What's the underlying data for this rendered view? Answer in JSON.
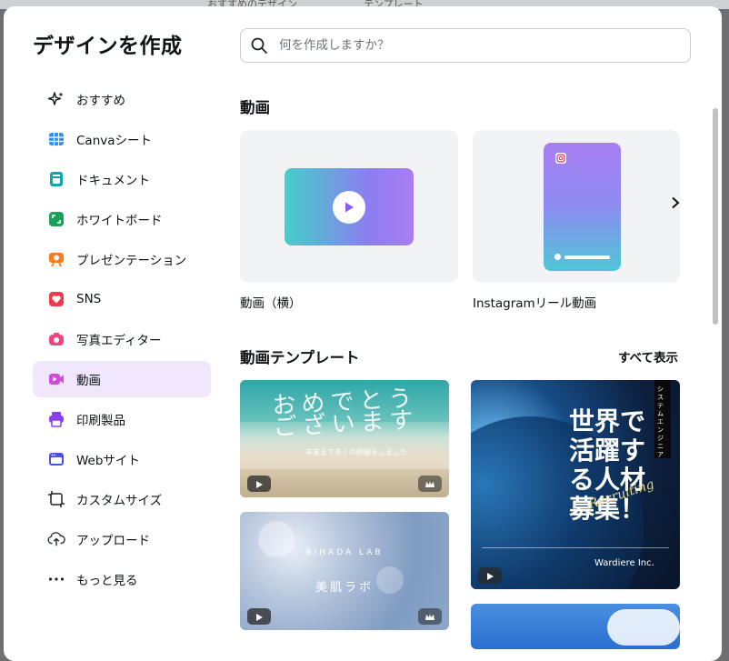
{
  "background": {
    "items": [
      "おすすめのデザイン",
      "テンプレート"
    ]
  },
  "title": "デザインを作成",
  "search": {
    "placeholder": "何を作成しますか？",
    "value": ""
  },
  "sidebar": {
    "items": [
      {
        "label": "おすすめ",
        "icon": "sparkle-icon",
        "color": "#1f2429"
      },
      {
        "label": "Canvaシート",
        "icon": "table-icon",
        "color": "#2f8fef"
      },
      {
        "label": "ドキュメント",
        "icon": "document-icon",
        "color": "#13a4b4"
      },
      {
        "label": "ホワイトボード",
        "icon": "whiteboard-icon",
        "color": "#19a05a"
      },
      {
        "label": "プレゼンテーション",
        "icon": "presentation-icon",
        "color": "#ff7b1a"
      },
      {
        "label": "SNS",
        "icon": "heart-icon",
        "color": "#ed3a4d"
      },
      {
        "label": "写真エディター",
        "icon": "camera-icon",
        "color": "#f0467d"
      },
      {
        "label": "動画",
        "icon": "video-icon",
        "color": "#d24ad8",
        "active": true
      },
      {
        "label": "印刷製品",
        "icon": "printer-icon",
        "color": "#8b3df0"
      },
      {
        "label": "Webサイト",
        "icon": "browser-icon",
        "color": "#4a4ff0"
      },
      {
        "label": "カスタムサイズ",
        "icon": "crop-icon",
        "color": "#1f2429"
      },
      {
        "label": "アップロード",
        "icon": "cloud-upload-icon",
        "color": "#1f2429"
      },
      {
        "label": "もっと見る",
        "icon": "more-icon",
        "color": "#1f2429"
      }
    ]
  },
  "main": {
    "section_video": {
      "title": "動画",
      "cards": [
        {
          "label": "動画（横）"
        },
        {
          "label": "Instagramリール動画"
        }
      ]
    },
    "section_templates": {
      "title": "動画テンプレート",
      "show_all": "すべて表示",
      "templates": [
        {
          "text": "おめでとうございます",
          "subtext": "卒業まで多くの経験をしました"
        },
        {
          "text": "美肌ラボ",
          "subtext": "BIHADA LAB"
        },
        {
          "text": "世界で活躍する人材募集！",
          "tag": "システムエンジニア",
          "script": "Recruiting",
          "company": "Wardiere Inc."
        }
      ]
    }
  },
  "colors": {
    "accent": "#8b3df0",
    "active_bg": "#f0e7fd",
    "thumb_bg": "#f2f3f5"
  }
}
